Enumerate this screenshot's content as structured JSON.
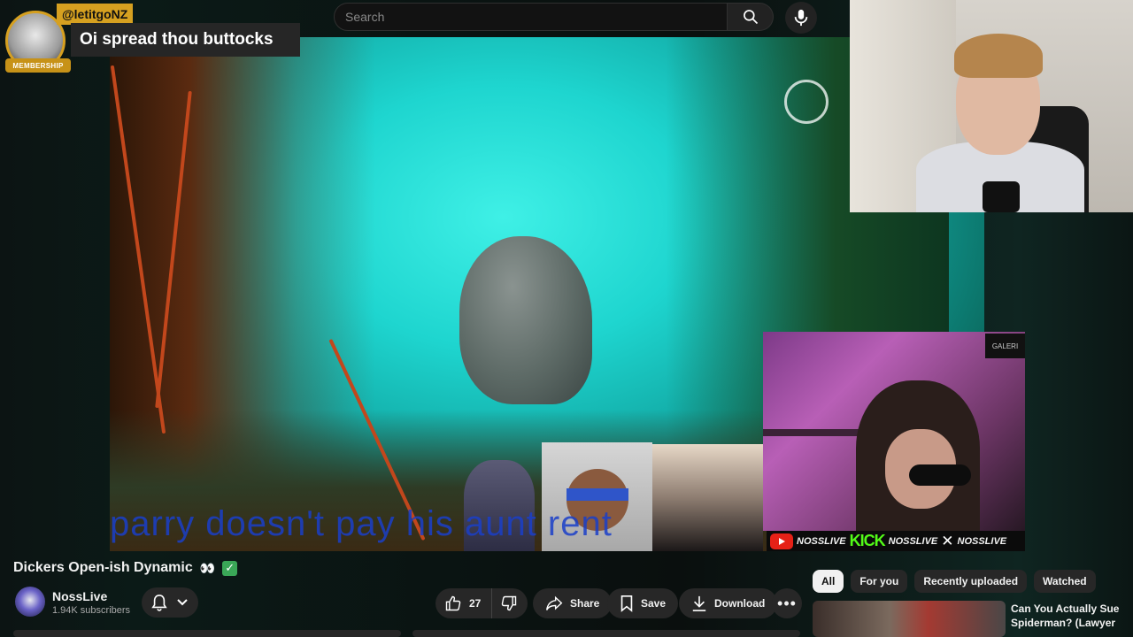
{
  "search": {
    "placeholder": "Search"
  },
  "chat": {
    "username": "@letitgoNZ",
    "badge": "MEMBERSHIP",
    "message": "Oi spread thou buttocks"
  },
  "video": {
    "overlay_lyric": "parry doesn't pay his aunt rent",
    "gallery_sign": "GALERI",
    "socials": [
      "NOSSLIVE",
      "KICK",
      "NOSSLIVE",
      "NOSSLIVE"
    ]
  },
  "meta": {
    "title": "Dickers Open-ish Dynamic",
    "title_emoji": "👀"
  },
  "channel": {
    "name": "NossLive",
    "subscribers": "1.94K subscribers"
  },
  "actions": {
    "likes": "27",
    "share": "Share",
    "save": "Save",
    "download": "Download"
  },
  "chips": [
    "All",
    "For you",
    "Recently uploaded",
    "Watched"
  ],
  "recommendation": {
    "title": "Can You Actually Sue Spiderman? (Lawyer"
  },
  "colors": {
    "accent_gold": "#d6a020",
    "kick_green": "#53fc18",
    "youtube_red": "#e62117",
    "verified_green": "#3aa757"
  }
}
